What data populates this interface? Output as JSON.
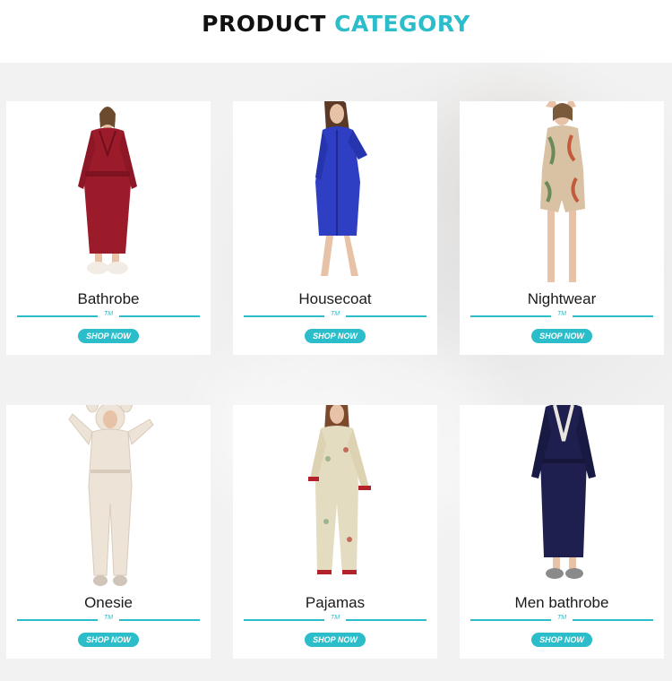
{
  "header": {
    "title_part1": "PRODUCT",
    "title_part2": "CATEGORY"
  },
  "colors": {
    "accent": "#2bbdc9",
    "title_dark": "#111111"
  },
  "products": [
    {
      "name": "Bathrobe",
      "tm": "TM",
      "button": "SHOP NOW",
      "garment_color": "#9b1b2b"
    },
    {
      "name": "Housecoat",
      "tm": "TM",
      "button": "SHOP NOW",
      "garment_color": "#2f3fc4"
    },
    {
      "name": "Nightwear",
      "tm": "TM",
      "button": "SHOP NOW",
      "garment_color": "#d9c1a4"
    },
    {
      "name": "Onesie",
      "tm": "TM",
      "button": "SHOP NOW",
      "garment_color": "#ede3d6"
    },
    {
      "name": "Pajamas",
      "tm": "TM",
      "button": "SHOP NOW",
      "garment_color": "#e4dcc0"
    },
    {
      "name": "Men bathrobe",
      "tm": "TM",
      "button": "SHOP NOW",
      "garment_color": "#1e1f4e"
    }
  ]
}
